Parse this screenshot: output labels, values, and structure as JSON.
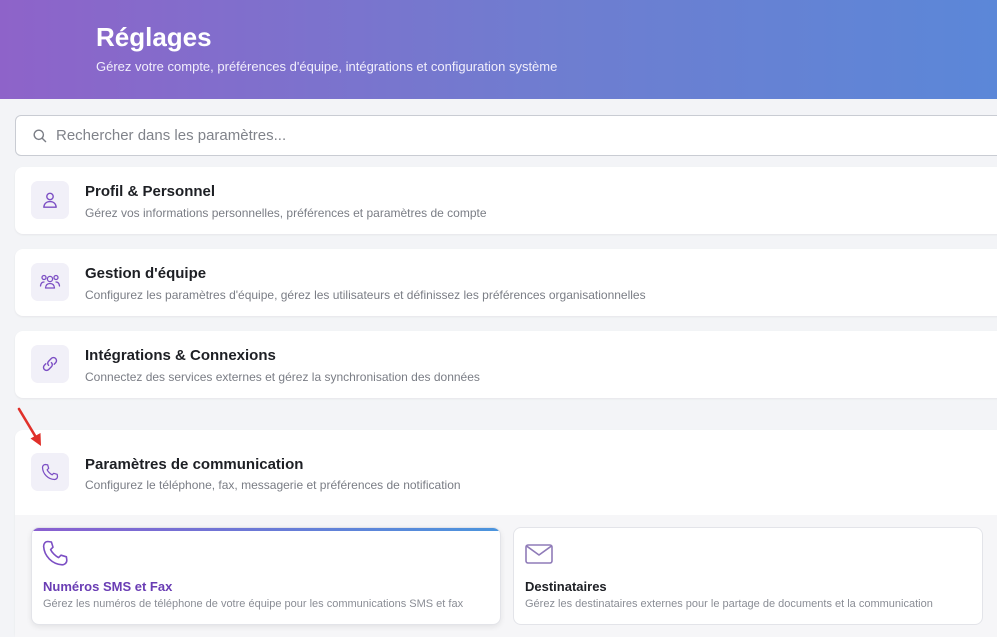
{
  "header": {
    "title": "Réglages",
    "subtitle": "Gérez votre compte, préférences d'équipe, intégrations et configuration système"
  },
  "search": {
    "placeholder": "Rechercher dans les paramètres..."
  },
  "sections": [
    {
      "title": "Profil & Personnel",
      "description": "Gérez vos informations personnelles, préférences et paramètres de compte",
      "icon": "user-icon"
    },
    {
      "title": "Gestion d'équipe",
      "description": "Configurez les paramètres d'équipe, gérez les utilisateurs et définissez les préférences organisationnelles",
      "icon": "team-icon"
    },
    {
      "title": "Intégrations & Connexions",
      "description": "Connectez des services externes et gérez la synchronisation des données",
      "icon": "link-icon"
    },
    {
      "title": "Paramètres de communication",
      "description": "Configurez le téléphone, fax, messagerie et préférences de notification",
      "icon": "phone-icon",
      "subsections": [
        {
          "title": "Numéros SMS et Fax",
          "description": "Gérez les numéros de téléphone de votre équipe pour les communications SMS et fax",
          "icon": "phone-icon",
          "active": true
        },
        {
          "title": "Destinataires",
          "description": "Gérez les destinataires externes pour le partage de documents et la communication",
          "icon": "mail-icon",
          "active": false
        }
      ]
    }
  ],
  "colors": {
    "accent": "#7c4fc4",
    "header_gradient_start": "#8e63c9",
    "header_gradient_end": "#5b87d8",
    "annotation_arrow": "#e0302a"
  }
}
